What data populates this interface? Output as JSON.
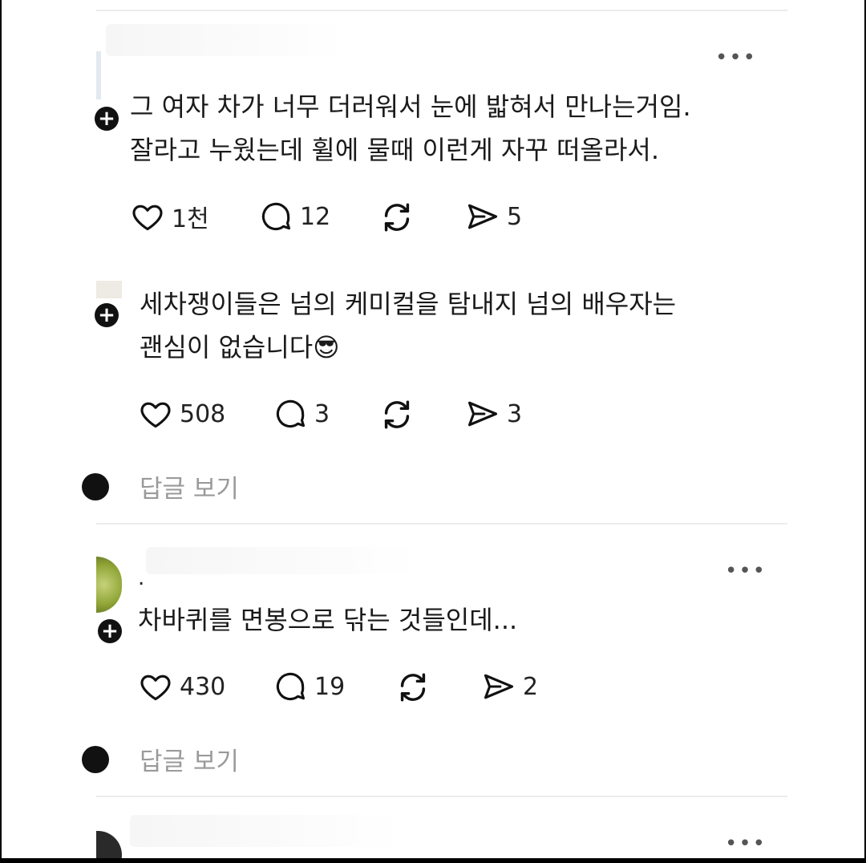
{
  "comments": [
    {
      "lines": [
        "그 여자 차가 너무 더러워서 눈에 밟혀서 만나는거임.",
        "잘라고 누웠는데 휠에 물때 이런게 자꾸 떠올라서."
      ],
      "likes": "1천",
      "replies": "12",
      "shares": "5"
    },
    {
      "lines": [
        "세차쟁이들은 넘의 케미컬을 탐내지 넘의 배우자는",
        "괜심이 없습니다"
      ],
      "emoji": "😎",
      "likes": "508",
      "replies": "3",
      "shares": "3",
      "view_replies": "답글 보기"
    },
    {
      "username": ".",
      "lines": [
        "차바퀴를 면봉으로 닦는 것들인데..."
      ],
      "likes": "430",
      "replies": "19",
      "shares": "2",
      "view_replies": "답글 보기"
    }
  ],
  "more_label": "•••",
  "plus_label": "+",
  "icons": {
    "like": "heart-icon",
    "reply": "speech-bubble-icon",
    "repost": "repost-icon",
    "share": "paper-plane-icon"
  }
}
